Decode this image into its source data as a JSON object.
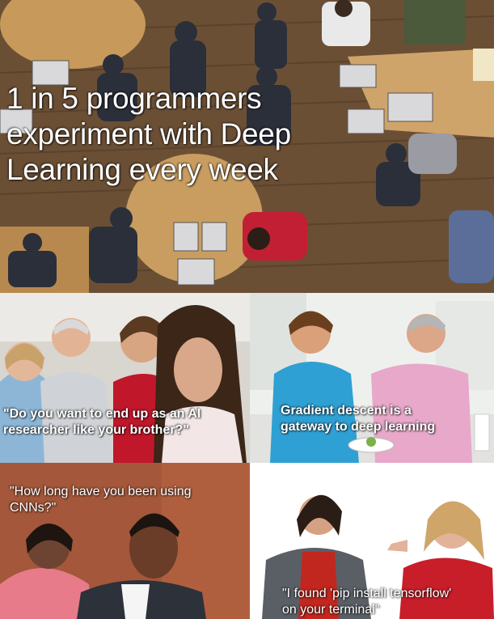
{
  "hero": {
    "lines": [
      "1 in 5 programmers",
      "experiment with Deep",
      "Learning every week"
    ]
  },
  "panels": [
    {
      "caption_lines": [
        "\"Do you want to end up as an AI",
        "researcher like your brother?\""
      ]
    },
    {
      "caption_lines": [
        "Gradient descent is a",
        "gateway to deep learning"
      ]
    },
    {
      "caption_lines": [
        "\"How long have you been using",
        "CNNs?\""
      ]
    },
    {
      "caption_lines": [
        "\"I found 'pip install tensorflow'",
        "on your terminal\""
      ]
    }
  ],
  "colors": {
    "caption_text": "#ffffff",
    "hero_floor": "#6e5236",
    "white_border": "#ffffff"
  }
}
